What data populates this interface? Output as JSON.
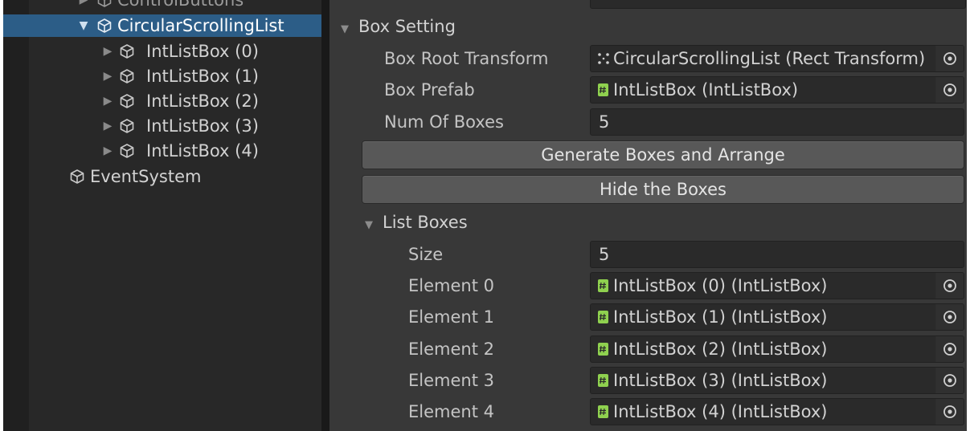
{
  "hierarchy": {
    "cut_item": "ControlButtons",
    "selected_item": "CircularScrollingList",
    "children": [
      "IntListBox (0)",
      "IntListBox (1)",
      "IntListBox (2)",
      "IntListBox (3)",
      "IntListBox (4)"
    ],
    "root_item": "EventSystem"
  },
  "inspector": {
    "section_title": "Box Setting",
    "box_root_transform": {
      "label": "Box Root Transform",
      "value": "CircularScrollingList (Rect Transform)"
    },
    "box_prefab": {
      "label": "Box Prefab",
      "value": "IntListBox (IntListBox)"
    },
    "num_of_boxes": {
      "label": "Num Of Boxes",
      "value": "5"
    },
    "generate_button": "Generate Boxes and Arrange",
    "hide_button": "Hide the Boxes",
    "list_boxes": {
      "title": "List Boxes",
      "size_label": "Size",
      "size_value": "5",
      "elements": [
        {
          "label": "Element 0",
          "value": "IntListBox (0) (IntListBox)"
        },
        {
          "label": "Element 1",
          "value": "IntListBox (1) (IntListBox)"
        },
        {
          "label": "Element 2",
          "value": "IntListBox (2) (IntListBox)"
        },
        {
          "label": "Element 3",
          "value": "IntListBox (3) (IntListBox)"
        },
        {
          "label": "Element 4",
          "value": "IntListBox (4) (IntListBox)"
        }
      ]
    }
  },
  "colors": {
    "selection": "#2c5d87",
    "inspector_bg": "#383838",
    "hierarchy_bg": "#282828",
    "field_bg": "#2a2a2a",
    "button_bg": "#585858",
    "script_icon": "#8fd14f"
  }
}
